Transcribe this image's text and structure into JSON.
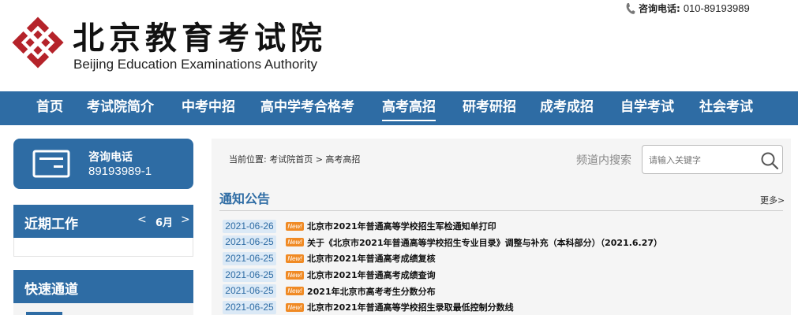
{
  "header": {
    "org_name_cn": "北京教育考试院",
    "org_name_en": "Beijing Education Examinations Authority",
    "hotline_label": "咨询电话:",
    "hotline_number": "010-89193989"
  },
  "nav": {
    "items": [
      {
        "label": "首页"
      },
      {
        "label": "考试院简介"
      },
      {
        "label": "中考中招"
      },
      {
        "label": "高中学考合格考"
      },
      {
        "label": "高考高招",
        "active": true
      },
      {
        "label": "研考研招"
      },
      {
        "label": "成考成招"
      },
      {
        "label": "自学考试"
      },
      {
        "label": "社会考试"
      }
    ]
  },
  "sidebar": {
    "contact_label": "咨询电话",
    "contact_number": "89193989-1",
    "recent_title": "近期工作",
    "month_prev": "<",
    "month_label": "6月",
    "month_next": ">",
    "quick_title": "快速通道"
  },
  "main": {
    "breadcrumb": "当前位置: 考试院首页 > 高考高招",
    "search_label": "频道内搜索",
    "search_placeholder": "请输入关键字",
    "section_title": "通知公告",
    "more_label": "更多>",
    "news": [
      {
        "date": "2021-06-26",
        "badge": "New!",
        "title": "北京市2021年普通高等学校招生军检通知单打印"
      },
      {
        "date": "2021-06-25",
        "badge": "New!",
        "title": "关于《北京市2021年普通高等学校招生专业目录》调整与补充（本科部分）（2021.6.27）"
      },
      {
        "date": "2021-06-25",
        "badge": "New!",
        "title": "北京市2021年普通高考成绩复核"
      },
      {
        "date": "2021-06-25",
        "badge": "New!",
        "title": "北京市2021年普通高考成绩查询"
      },
      {
        "date": "2021-06-25",
        "badge": "New!",
        "title": "2021年北京市高考考生分数分布"
      },
      {
        "date": "2021-06-25",
        "badge": "New!",
        "title": "北京市2021年普通高等学校招生录取最低控制分数线"
      }
    ]
  },
  "colors": {
    "brand_blue": "#2e6ca4",
    "logo_red": "#b5232a",
    "badge_orange": "#f08a24",
    "date_bg": "#dbe9f6"
  }
}
